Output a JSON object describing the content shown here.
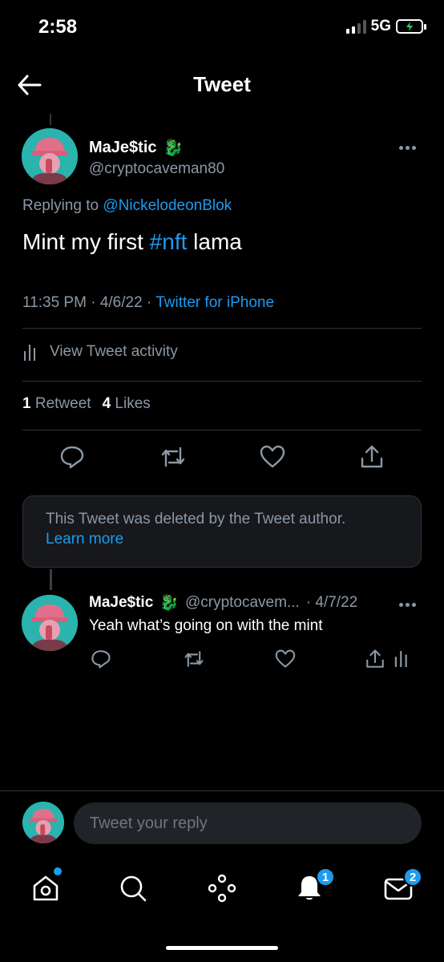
{
  "status_bar": {
    "time": "2:58",
    "network": "5G"
  },
  "header": {
    "title": "Tweet"
  },
  "tweet": {
    "author_name": "MaJe$tic",
    "author_emoji": "🐉",
    "author_handle": "@cryptocaveman80",
    "replying_prefix": "Replying to",
    "replying_handle": "@NickelodeonBlok",
    "text_before": "Mint my first",
    "hashtag": "#nft",
    "text_after": "lama",
    "time": "11:35 PM",
    "date": "4/6/22",
    "source": "Twitter for iPhone",
    "activity_label": "View Tweet activity",
    "retweet_count": "1",
    "retweet_label": "Retweet",
    "like_count": "4",
    "like_label": "Likes"
  },
  "deleted_notice": {
    "text": "This Tweet was deleted by the Tweet author.",
    "link": "Learn more"
  },
  "reply": {
    "author_name": "MaJe$tic",
    "author_emoji": "🐉",
    "author_handle": "@cryptocavem...",
    "date": "· 4/7/22",
    "text": "Yeah what’s going on with the mint"
  },
  "compose": {
    "placeholder": "Tweet your reply"
  },
  "tab_bar": {
    "notifications_badge": "1",
    "messages_badge": "2"
  },
  "colors": {
    "accent": "#1d9bf0",
    "background": "#000000",
    "secondary_text": "#8b98a5"
  }
}
